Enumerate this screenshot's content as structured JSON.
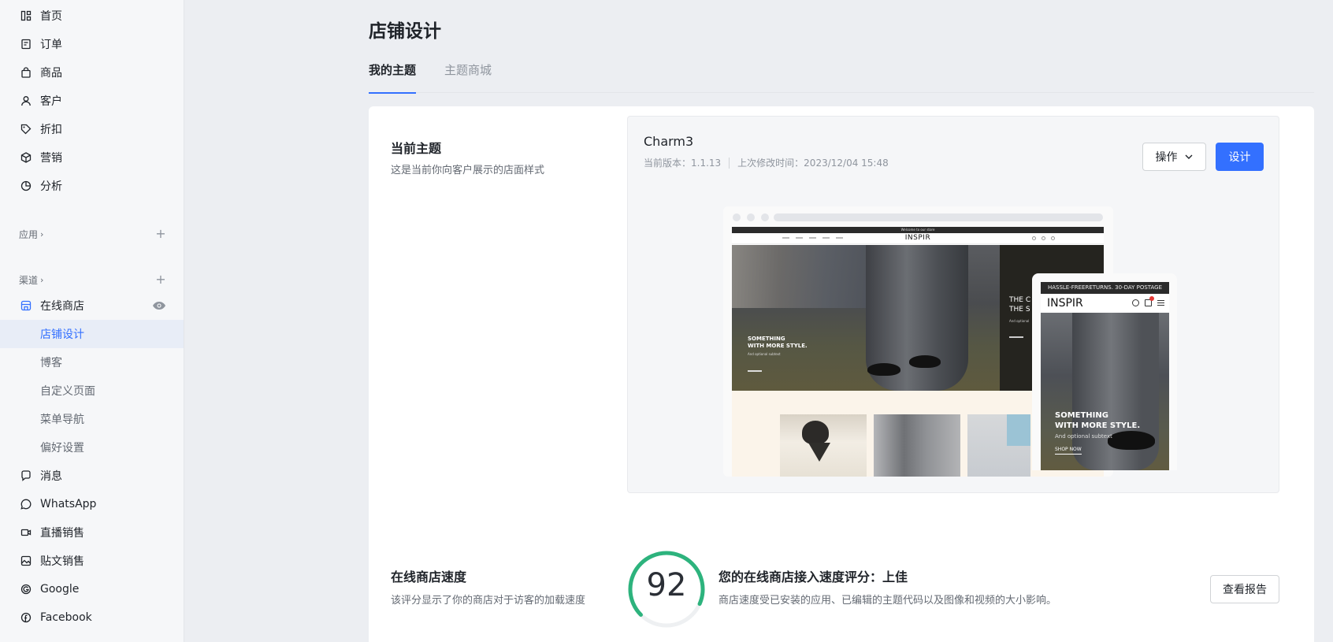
{
  "sidebar": {
    "main_items": [
      {
        "label": "首页",
        "icon": "dashboard-icon"
      },
      {
        "label": "订单",
        "icon": "order-icon"
      },
      {
        "label": "商品",
        "icon": "bag-icon"
      },
      {
        "label": "客户",
        "icon": "user-icon"
      },
      {
        "label": "折扣",
        "icon": "tag-icon"
      },
      {
        "label": "营销",
        "icon": "cube-icon"
      },
      {
        "label": "分析",
        "icon": "pie-chart-icon"
      }
    ],
    "apps_label": "应用",
    "channels_label": "渠道",
    "online_store_label": "在线商店",
    "store_sub_items": [
      {
        "label": "店铺设计",
        "active": true
      },
      {
        "label": "博客",
        "active": false
      },
      {
        "label": "自定义页面",
        "active": false
      },
      {
        "label": "菜单导航",
        "active": false
      },
      {
        "label": "偏好设置",
        "active": false
      }
    ],
    "channel_items": [
      {
        "label": "消息",
        "icon": "message-icon"
      },
      {
        "label": "WhatsApp",
        "icon": "whatsapp-icon"
      },
      {
        "label": "直播销售",
        "icon": "live-video-icon"
      },
      {
        "label": "贴文销售",
        "icon": "post-image-icon"
      },
      {
        "label": "Google",
        "icon": "google-icon"
      },
      {
        "label": "Facebook",
        "icon": "facebook-icon"
      }
    ]
  },
  "page": {
    "title": "店铺设计",
    "tabs": [
      {
        "label": "我的主题",
        "active": true
      },
      {
        "label": "主题商城",
        "active": false
      }
    ]
  },
  "current_theme": {
    "section_title": "当前主题",
    "section_desc": "这是当前你向客户展示的店面样式",
    "name": "Charm3",
    "version": "当前版本：1.1.13",
    "modified": "上次修改时间：2023/12/04 15:48",
    "ops_label": "操作",
    "design_label": "设计"
  },
  "preview": {
    "desktop_logo": "INSPIR",
    "desktop_announce": "Welcome to our store",
    "desktop_hero_title": "SOMETHING\nWITH MORE STYLE.",
    "desktop_hero_sub": "And optional subtext",
    "desktop_right_title": "THE C\nTHE S",
    "desktop_right_sub": "And optional",
    "mobile_announce": "HASSLE-FREERETURNS. 30-DAY POSTAGE PAID",
    "mobile_logo": "INSPIR",
    "mobile_hero_title": "SOMETHING\nWITH MORE STYLE.",
    "mobile_hero_sub": "And optional subtext",
    "mobile_hero_cta": "SHOP NOW"
  },
  "speed": {
    "section_title": "在线商店速度",
    "section_desc": "该评分显示了你的商店对于访客的加载速度",
    "score": 92,
    "score_color": "#2db37d",
    "headline": "您的在线商店接入速度评分：上佳",
    "desc": "商店速度受已安装的应用、已编辑的主题代码以及图像和视频的大小影响。",
    "report_label": "查看报告"
  },
  "colors": {
    "accent": "#3370ff",
    "sidebar_bg": "#f6f7f9",
    "page_bg": "#eceef2"
  }
}
